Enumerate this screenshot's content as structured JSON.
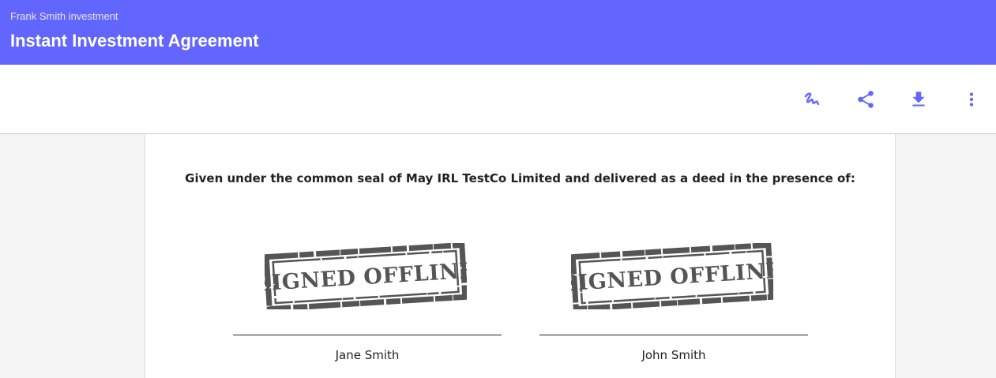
{
  "header": {
    "subtitle": "Frank Smith investment",
    "title": "Instant Investment Agreement"
  },
  "toolbar": {
    "icons": [
      "signature-icon",
      "share-icon",
      "download-icon",
      "more-vert-icon"
    ],
    "accent_color": "#6366fe"
  },
  "document": {
    "deed_statement": "Given under the common seal of May IRL TestCo Limited and delivered as a deed in the presence of:",
    "signatures": [
      {
        "stamp_text": "SIGNED OFFLINE",
        "name": "Jane Smith"
      },
      {
        "stamp_text": "SIGNED OFFLINE",
        "name": "John Smith"
      }
    ]
  },
  "colors": {
    "header_bg": "#6366fe",
    "stamp_ink": "#555555"
  }
}
